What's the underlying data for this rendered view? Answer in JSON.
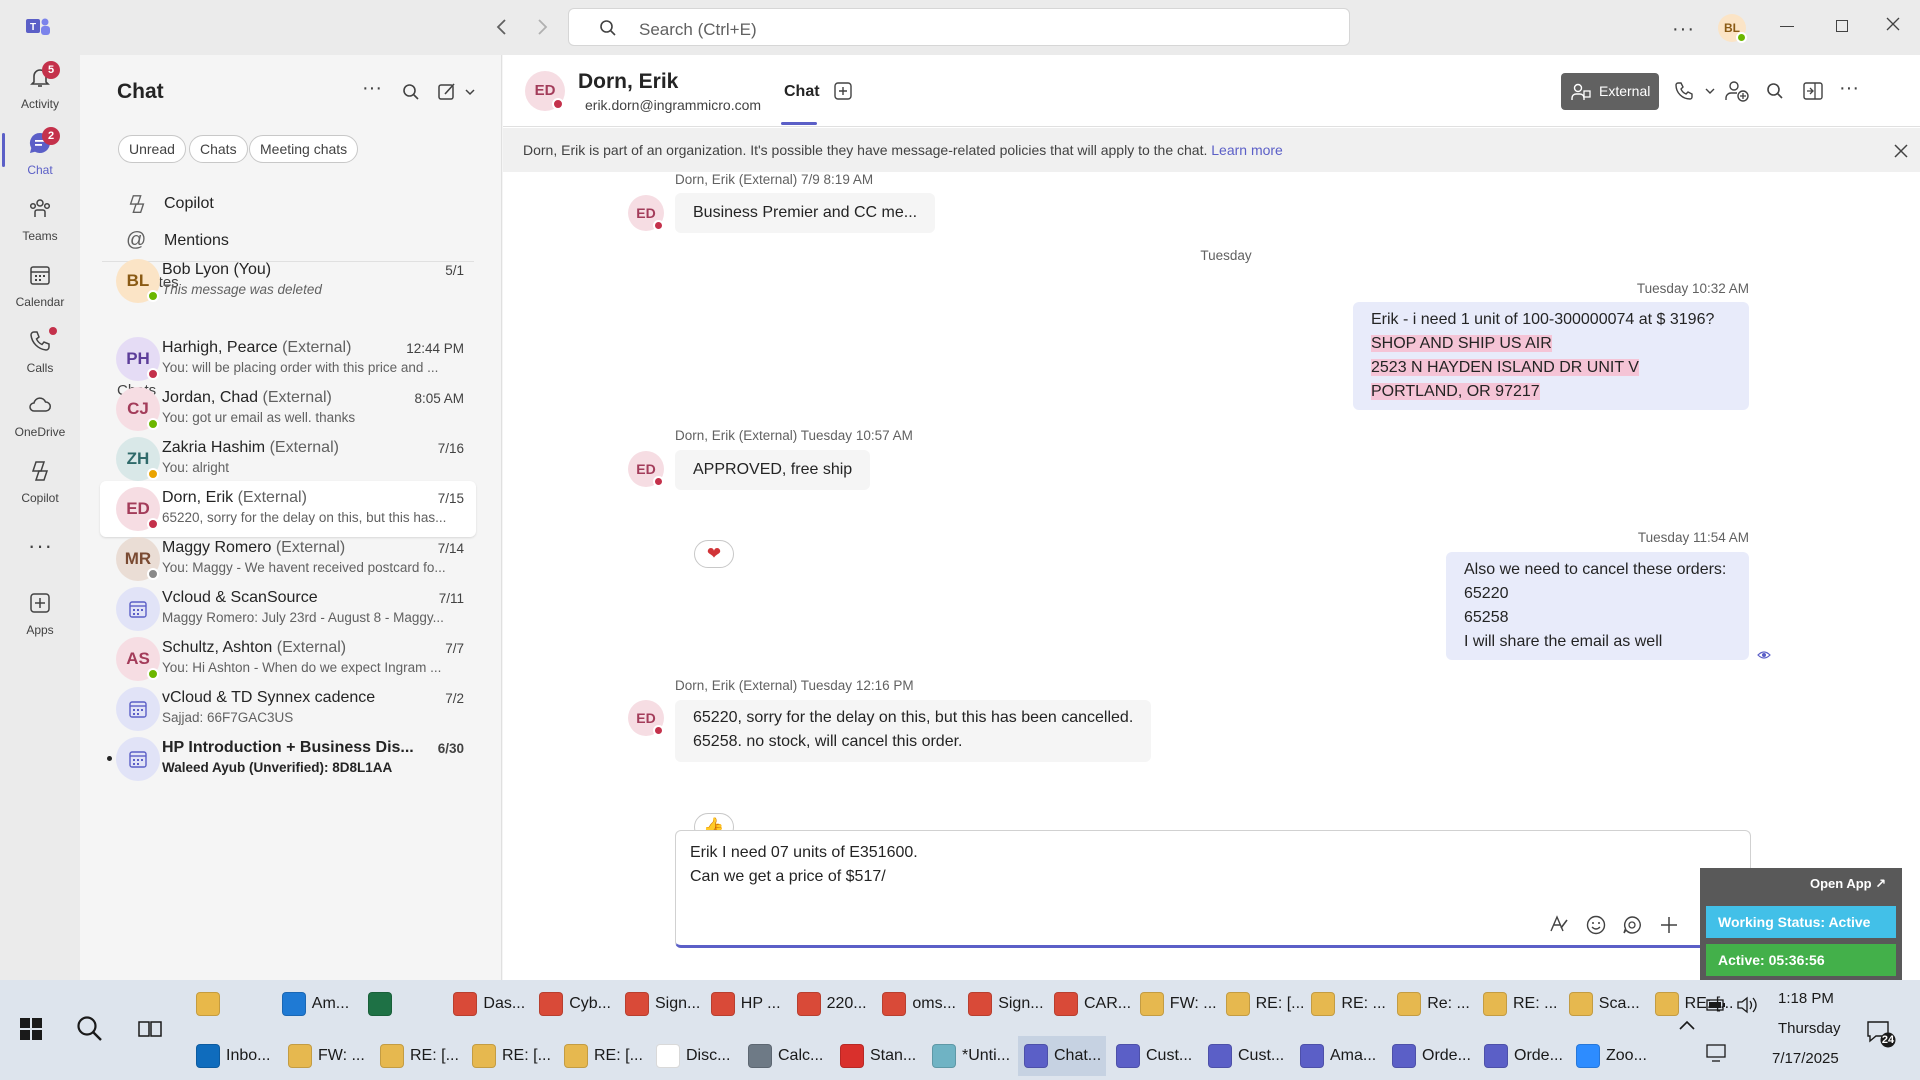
{
  "titlebar": {
    "search_placeholder": "Search (Ctrl+E)",
    "user_initials": "BL"
  },
  "rail": [
    {
      "label": "Activity",
      "badge": "5",
      "icon": "bell-icon"
    },
    {
      "label": "Chat",
      "badge": "2",
      "icon": "chat-icon",
      "selected": true
    },
    {
      "label": "Teams",
      "icon": "teams-icon"
    },
    {
      "label": "Calendar",
      "icon": "calendar-icon"
    },
    {
      "label": "Calls",
      "icon": "phone-icon"
    },
    {
      "label": "OneDrive",
      "icon": "cloud-icon"
    },
    {
      "label": "Copilot",
      "icon": "copilot-icon"
    },
    {
      "label": "Apps",
      "icon": "add-app-icon"
    }
  ],
  "chatlist": {
    "title": "Chat",
    "filters": [
      "Unread",
      "Chats",
      "Meeting chats"
    ],
    "pinned": [
      "Copilot",
      "Mentions"
    ],
    "favorites_header": "Favorites",
    "chats_header": "Chats",
    "favorites": [
      {
        "initials": "BL",
        "name": "Bob Lyon (You)",
        "ext": "",
        "preview": "This message was deleted",
        "date": "5/1",
        "color": "#fbe4c6",
        "fg": "#8a5a14",
        "presence": "#6bb700"
      }
    ],
    "chats": [
      {
        "initials": "PH",
        "name": "Harhigh, Pearce",
        "ext": "(External)",
        "preview": "You: will be placing order with this price and ...",
        "date": "12:44 PM",
        "color": "#e5dcf5",
        "fg": "#5c3d99",
        "presence": "#c4314b"
      },
      {
        "initials": "CJ",
        "name": "Jordan, Chad",
        "ext": "(External)",
        "preview": "You: got ur email as well. thanks",
        "date": "8:05 AM",
        "color": "#f6dde3",
        "fg": "#a33c5a",
        "presence": "#6bb700"
      },
      {
        "initials": "ZH",
        "name": "Zakria Hashim",
        "ext": "(External)",
        "preview": "You: alright",
        "date": "7/16",
        "color": "#d9e8e8",
        "fg": "#2f6a6a",
        "presence": "#eaa300"
      },
      {
        "initials": "ED",
        "name": "Dorn, Erik",
        "ext": "(External)",
        "preview": "65220, sorry for the delay on this, but this has...",
        "date": "7/15",
        "color": "#f6dde3",
        "fg": "#a33c5a",
        "presence": "#c4314b",
        "selected": true
      },
      {
        "initials": "MR",
        "name": "Maggy Romero",
        "ext": "(External)",
        "preview": "You: Maggy - We havent received postcard fo...",
        "date": "7/14",
        "color": "#eaddd5",
        "fg": "#7a4a32",
        "presence": "#8a8a8a"
      },
      {
        "initials": "",
        "name": "Vcloud & ScanSource",
        "ext": "",
        "preview": "Maggy Romero: July 23rd - August 8 - Maggy...",
        "date": "7/11",
        "color": "#e1e3f7",
        "fg": "#5b5fc7",
        "meeting": true
      },
      {
        "initials": "AS",
        "name": "Schultz, Ashton",
        "ext": "(External)",
        "preview": "You: Hi Ashton -  When do we expect Ingram ...",
        "date": "7/7",
        "color": "#f6dde3",
        "fg": "#a33c5a",
        "presence": "#6bb700"
      },
      {
        "initials": "",
        "name": "vCloud & TD Synnex cadence",
        "ext": "",
        "preview": "Sajjad: 66F7GAC3US",
        "date": "7/2",
        "color": "#e1e3f7",
        "fg": "#5b5fc7",
        "meeting": true
      },
      {
        "initials": "",
        "name": "HP Introduction + Business Dis...",
        "ext": "",
        "preview": "Waleed Ayub (Unverified): 8D8L1AA",
        "date": "6/30",
        "color": "#e1e3f7",
        "fg": "#5b5fc7",
        "meeting": true,
        "unread": true
      }
    ]
  },
  "chathead": {
    "initials": "ED",
    "name": "Dorn, Erik",
    "email": "erik.dorn@ingrammicro.com",
    "tab": "Chat",
    "external_label": "External"
  },
  "notice": {
    "text": "Dorn, Erik is part of an organization. It's possible they have message-related policies that will apply to the chat. ",
    "link": "Learn more"
  },
  "messages": {
    "m1_meta": "Dorn, Erik (External)   7/9 8:19 AM",
    "m1_text": "Business Premier and CC me...",
    "divider": "Tuesday",
    "m2_meta": "Tuesday 10:32 AM",
    "m2_lines": [
      "Erik  -  i need 1 unit of 100-300000074 at $ 3196?",
      "SHOP AND SHIP US AIR",
      "2523 N HAYDEN ISLAND DR UNIT V",
      "PORTLAND, OR 97217"
    ],
    "m3_meta": "Dorn, Erik (External)   Tuesday 10:57 AM",
    "m3_text": "APPROVED, free ship",
    "m3_reaction": "❤",
    "m4_meta": "Tuesday 11:54 AM",
    "m4_lines": [
      "Also we need to cancel these orders:",
      "65220",
      "65258",
      "I will share the email as well"
    ],
    "m5_meta": "Dorn, Erik (External)   Tuesday 12:16 PM",
    "m5_lines": [
      "65220, sorry for the delay on this, but this has been cancelled.",
      "65258. no stock, will cancel this order."
    ],
    "m5_reaction": "👍"
  },
  "compose": {
    "line1": "Erik I need 07 units of E351600.",
    "line2": "Can we get a price of $517/"
  },
  "widget": {
    "open_app": "Open App ↗",
    "status": "Working Status: Active",
    "active": "Active: 05:36:56"
  },
  "taskbar": {
    "row1": [
      {
        "label": "",
        "color": "#e8b84a"
      },
      {
        "label": "Am...",
        "color": "#1f7ad4"
      },
      {
        "label": "",
        "color": "#1e7145"
      },
      {
        "label": "Das...",
        "color": "#d94a38"
      },
      {
        "label": "Cyb...",
        "color": "#d94a38"
      },
      {
        "label": "Sign...",
        "color": "#d94a38"
      },
      {
        "label": "HP ...",
        "color": "#d94a38"
      },
      {
        "label": "220...",
        "color": "#d94a38"
      },
      {
        "label": "oms...",
        "color": "#d94a38"
      },
      {
        "label": "Sign...",
        "color": "#d94a38"
      },
      {
        "label": "CAR...",
        "color": "#d94a38"
      },
      {
        "label": "FW: ...",
        "color": "#e6b84f"
      },
      {
        "label": "RE: [...",
        "color": "#e6b84f"
      },
      {
        "label": "RE: ...",
        "color": "#e6b84f"
      },
      {
        "label": "Re: ...",
        "color": "#e6b84f"
      },
      {
        "label": "RE: ...",
        "color": "#e6b84f"
      },
      {
        "label": "Sca...",
        "color": "#e6b84f"
      },
      {
        "label": "RE: [...",
        "color": "#e6b84f"
      }
    ],
    "row2": [
      {
        "label": "Inbo...",
        "color": "#0f6cbd"
      },
      {
        "label": "FW: ...",
        "color": "#e6b84f"
      },
      {
        "label": "RE: [...",
        "color": "#e6b84f"
      },
      {
        "label": "RE: [...",
        "color": "#e6b84f"
      },
      {
        "label": "RE: [...",
        "color": "#e6b84f"
      },
      {
        "label": "Disc...",
        "color": "#ffffff"
      },
      {
        "label": "Calc...",
        "color": "#6e7a86"
      },
      {
        "label": "Stan...",
        "color": "#d9302c"
      },
      {
        "label": "*Unti...",
        "color": "#6fb3c4"
      },
      {
        "label": "Chat...",
        "color": "#5b5fc7"
      },
      {
        "label": "Cust...",
        "color": "#5b5fc7"
      },
      {
        "label": "Cust...",
        "color": "#5b5fc7"
      },
      {
        "label": "Ama...",
        "color": "#5b5fc7"
      },
      {
        "label": "Orde...",
        "color": "#5b5fc7"
      },
      {
        "label": "Orde...",
        "color": "#5b5fc7"
      },
      {
        "label": "Zoo...",
        "color": "#2d8cff"
      }
    ],
    "time": "1:18 PM",
    "day": "Thursday",
    "date": "7/17/2025",
    "notif_count": "24"
  }
}
